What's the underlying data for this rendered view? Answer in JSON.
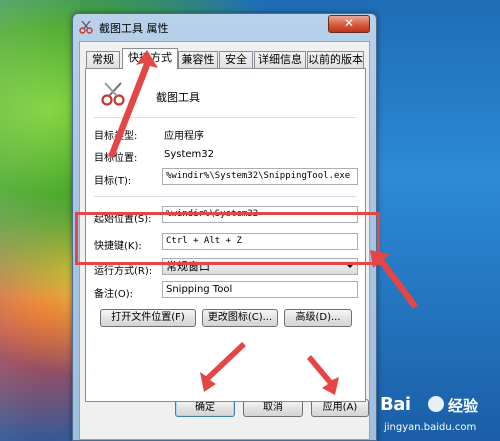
{
  "window": {
    "title": "截图工具 属性",
    "close_glyph": "✕"
  },
  "tabs": [
    {
      "label": "常规"
    },
    {
      "label": "快捷方式"
    },
    {
      "label": "兼容性"
    },
    {
      "label": "安全"
    },
    {
      "label": "详细信息"
    },
    {
      "label": "以前的版本"
    }
  ],
  "app": {
    "name": "截图工具",
    "icon": "scissors-icon"
  },
  "fields": {
    "target_type_label": "目标类型:",
    "target_type_value": "应用程序",
    "target_location_label": "目标位置:",
    "target_location_value": "System32",
    "target_label": "目标(T):",
    "target_value": "%windir%\\System32\\SnippingTool.exe",
    "start_in_label": "起始位置(S):",
    "start_in_value": "%windir%\\System32",
    "shortcut_key_label": "快捷键(K):",
    "shortcut_key_value": "Ctrl + Alt + Z",
    "run_label": "运行方式(R):",
    "run_value": "常规窗口",
    "comment_label": "备注(O):",
    "comment_value": "Snipping Tool"
  },
  "buttons": {
    "open_location": "打开文件位置(F)",
    "change_icon": "更改图标(C)...",
    "advanced": "高级(D)...",
    "ok": "确定",
    "cancel": "取消",
    "apply": "应用(A)"
  },
  "annotation": {
    "highlight_color": "#e44646",
    "arrow_color": "#e44646"
  },
  "watermark": {
    "logo": "Bai",
    "brand": "经验",
    "url": "jingyan.baidu.com"
  }
}
